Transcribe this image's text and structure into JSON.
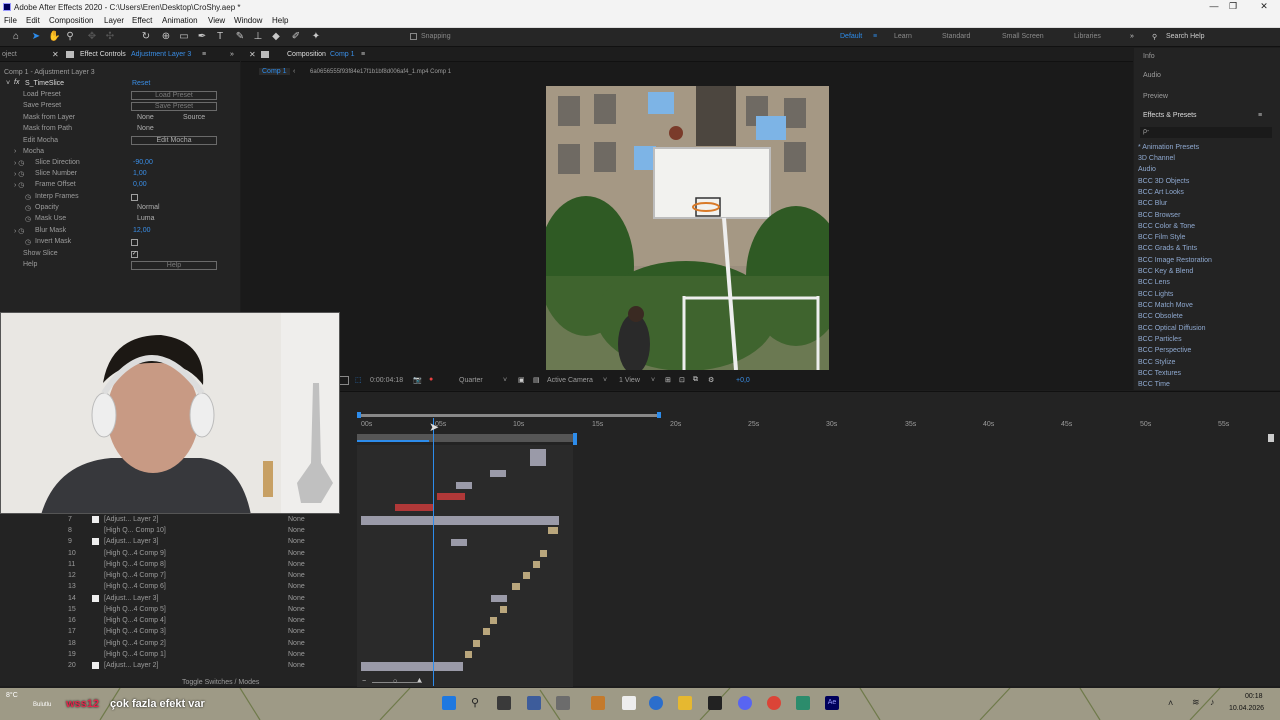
{
  "titlebar": {
    "title": "Adobe After Effects 2020 - C:\\Users\\Eren\\Desktop\\CroShy.aep *"
  },
  "menu": [
    "File",
    "Edit",
    "Composition",
    "Layer",
    "Effect",
    "Animation",
    "View",
    "Window",
    "Help"
  ],
  "toolbar": {
    "snapping": "Snapping",
    "workspaces": [
      "Default",
      "Learn",
      "Standard",
      "Small Screen",
      "Libraries"
    ],
    "search_placeholder": "Search Help"
  },
  "effect_controls": {
    "tab_project": "oject",
    "tab_label": "Effect Controls",
    "tab_layer": "Adjustment Layer 3",
    "breadcrumb": "Comp 1 - Adjustment Layer 3",
    "effect_name": "S_TimeSlice",
    "reset": "Reset",
    "rows": [
      {
        "label": "Load Preset",
        "button": "Load Preset"
      },
      {
        "label": "Save Preset",
        "button": "Save Preset"
      },
      {
        "label": "Mask from Layer",
        "value": "None",
        "value2": "Source"
      },
      {
        "label": "Mask from Path",
        "value": "None"
      },
      {
        "label": "Edit Mocha",
        "button": "Edit Mocha"
      },
      {
        "label": "Mocha"
      },
      {
        "label": "Slice Direction",
        "value": "-90,00"
      },
      {
        "label": "Slice Number",
        "value": "1,00"
      },
      {
        "label": "Frame Offset",
        "value": "0,00"
      },
      {
        "label": "Interp Frames"
      },
      {
        "label": "Opacity",
        "value": "Normal"
      },
      {
        "label": "Mask Use",
        "value": "Luma"
      },
      {
        "label": "Blur Mask",
        "value": "12,00"
      },
      {
        "label": "Invert Mask"
      },
      {
        "label": "Show Slice"
      },
      {
        "label": "Help",
        "button": "Help"
      }
    ]
  },
  "composition": {
    "tab_label": "Composition",
    "tab_name": "Comp 1",
    "sub_tab": "Comp 1",
    "path": "6a0656555f93f84e17f1b1bf8d006af4_1.mp4 Comp 1",
    "timecode": "0:00:04:18",
    "resolution": "Quarter",
    "camera": "Active Camera",
    "views": "1 View",
    "exposure": "+0,0"
  },
  "right_panel": {
    "info": "Info",
    "audio": "Audio",
    "preview": "Preview",
    "effects_presets": "Effects & Presets",
    "search_placeholder": "ρ-",
    "items": [
      "* Animation Presets",
      "3D Channel",
      "Audio",
      "BCC 3D Objects",
      "BCC Art Looks",
      "BCC Blur",
      "BCC Browser",
      "BCC Color & Tone",
      "BCC Film Style",
      "BCC Grads & Tints",
      "BCC Image Restoration",
      "BCC Key & Blend",
      "BCC Lens",
      "BCC Lights",
      "BCC Match Move",
      "BCC Obsolete",
      "BCC Optical Diffusion",
      "BCC Particles",
      "BCC Perspective",
      "BCC Stylize",
      "BCC Textures",
      "BCC Time"
    ]
  },
  "timeline": {
    "ruler": [
      "00s",
      "05s",
      "10s",
      "15s",
      "20s",
      "25s",
      "30s",
      "35s",
      "40s",
      "45s",
      "50s",
      "55s"
    ],
    "playhead_seconds": 4.6,
    "toggle_label": "Toggle Switches / Modes",
    "layers": [
      {
        "num": "7",
        "name": "[Adjust... Layer 2]",
        "mode": "None"
      },
      {
        "num": "8",
        "name": "[High Q... Comp 10]",
        "mode": "None"
      },
      {
        "num": "9",
        "name": "[Adjust... Layer 3]",
        "mode": "None"
      },
      {
        "num": "10",
        "name": "[High Q...4 Comp 9]",
        "mode": "None"
      },
      {
        "num": "11",
        "name": "[High Q...4 Comp 8]",
        "mode": "None"
      },
      {
        "num": "12",
        "name": "[High Q...4 Comp 7]",
        "mode": "None"
      },
      {
        "num": "13",
        "name": "[High Q...4 Comp 6]",
        "mode": "None"
      },
      {
        "num": "14",
        "name": "[Adjust... Layer 3]",
        "mode": "None"
      },
      {
        "num": "15",
        "name": "[High Q...4 Comp 5]",
        "mode": "None"
      },
      {
        "num": "16",
        "name": "[High Q...4 Comp 4]",
        "mode": "None"
      },
      {
        "num": "17",
        "name": "[High Q...4 Comp 3]",
        "mode": "None"
      },
      {
        "num": "18",
        "name": "[High Q...4 Comp 2]",
        "mode": "None"
      },
      {
        "num": "19",
        "name": "[High Q...4 Comp 1]",
        "mode": "None"
      },
      {
        "num": "20",
        "name": "[Adjust... Layer 2]",
        "mode": "None"
      }
    ]
  },
  "caption": {
    "user": "wss12",
    "message": "çok fazla efekt var"
  },
  "taskbar": {
    "weather": "8°C",
    "weather_sub": "Bulutlu",
    "time": "00:18",
    "date": "10.04.2026"
  },
  "colors": {
    "accent_blue": "#2d8ceb",
    "layer_red": "#b03838",
    "layer_gray": "#9a9aa8",
    "layer_tan": "#b9a67c"
  }
}
